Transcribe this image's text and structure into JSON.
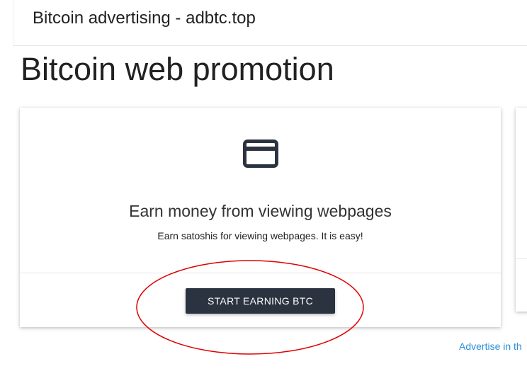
{
  "header": {
    "site_title": "Bitcoin advertising - adbtc.top"
  },
  "main": {
    "page_title": "Bitcoin web promotion"
  },
  "card": {
    "icon": "credit-card-icon",
    "heading": "Earn money from viewing webpages",
    "description": "Earn satoshis for viewing webpages. It is easy!",
    "button_label": "START EARNING BTC"
  },
  "footer": {
    "advertise_link": "Advertise in th"
  },
  "colors": {
    "button_bg": "#2b3340",
    "link": "#2a8fd6",
    "annotation": "#e00000"
  }
}
